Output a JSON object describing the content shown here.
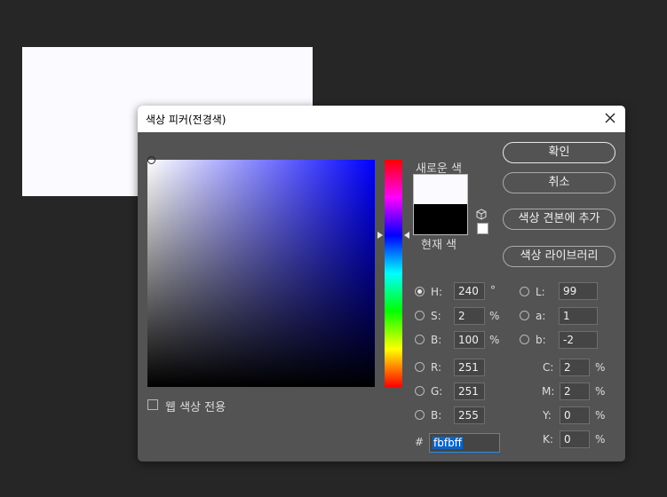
{
  "dialog": {
    "title": "색상 피커(전경색)"
  },
  "swatch": {
    "new_label": "새로운 색",
    "current_label": "현재 색",
    "new_color": "#fbfbff",
    "current_color": "#000000"
  },
  "buttons": {
    "ok": "확인",
    "cancel": "취소",
    "add_swatch": "색상 견본에 추가",
    "libraries": "색상 라이브러리"
  },
  "hsb": {
    "h": {
      "label": "H:",
      "value": "240",
      "unit": "°"
    },
    "s": {
      "label": "S:",
      "value": "2",
      "unit": "%"
    },
    "b": {
      "label": "B:",
      "value": "100",
      "unit": "%"
    }
  },
  "rgb": {
    "r": {
      "label": "R:",
      "value": "251"
    },
    "g": {
      "label": "G:",
      "value": "251"
    },
    "b": {
      "label": "B:",
      "value": "255"
    }
  },
  "lab": {
    "l": {
      "label": "L:",
      "value": "99"
    },
    "a": {
      "label": "a:",
      "value": "1"
    },
    "b": {
      "label": "b:",
      "value": "-2"
    }
  },
  "cmyk": {
    "c": {
      "label": "C:",
      "value": "2",
      "unit": "%"
    },
    "m": {
      "label": "M:",
      "value": "2",
      "unit": "%"
    },
    "y": {
      "label": "Y:",
      "value": "0",
      "unit": "%"
    },
    "k": {
      "label": "K:",
      "value": "0",
      "unit": "%"
    }
  },
  "hex": {
    "label": "#",
    "value": "fbfbff"
  },
  "web_only": {
    "label": "웹 색상 전용"
  },
  "picker": {
    "hue_color": "#0000ff",
    "selected_hue_deg": 240
  },
  "icons": {
    "close": "close-icon",
    "gamut": "cube-icon"
  }
}
